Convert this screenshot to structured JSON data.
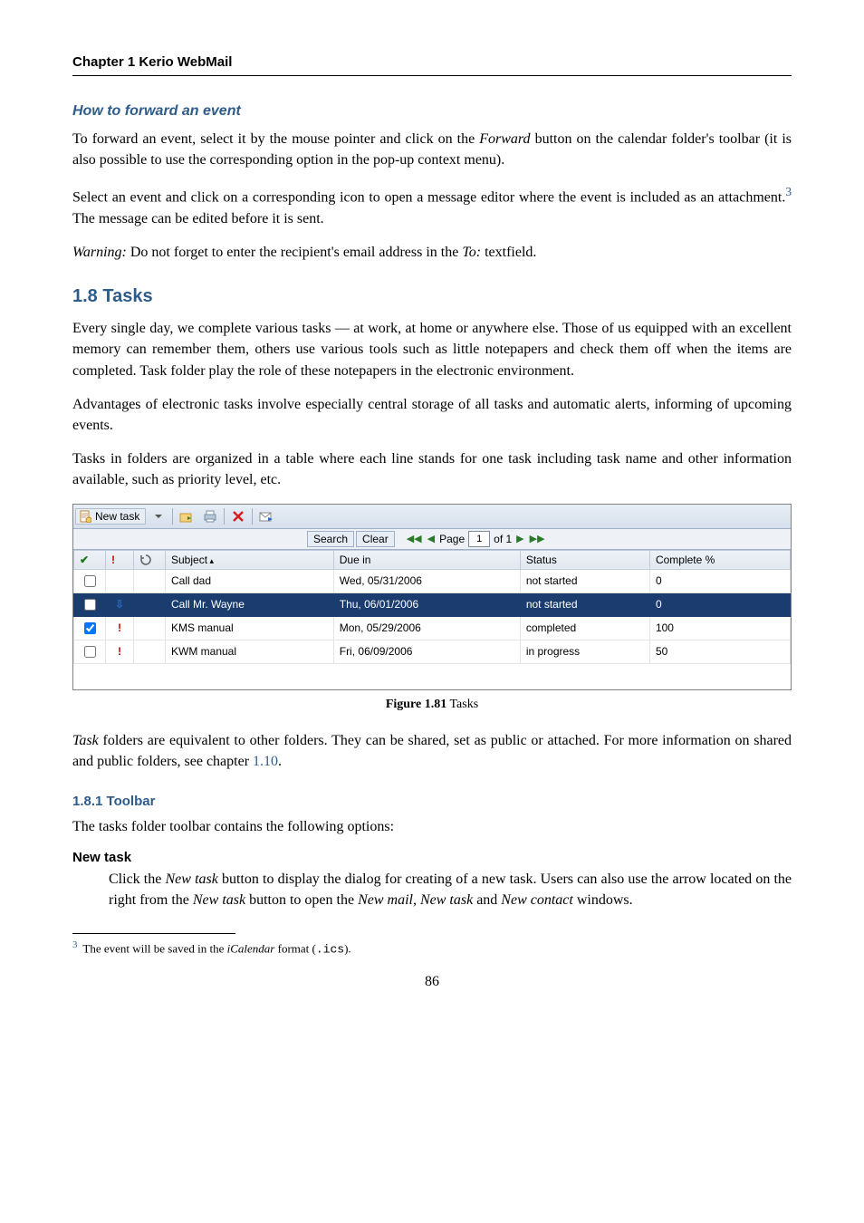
{
  "chapter_header": "Chapter 1  Kerio WebMail",
  "section_forward": {
    "title": "How to forward an event",
    "p1_a": "To forward an event, select it by the mouse pointer and click on the ",
    "p1_em": "Forward",
    "p1_b": " button on the calendar folder's toolbar (it is also possible to use the corresponding option in the pop-up context menu).",
    "p2_a": "Select an event and click on a corresponding icon to open a message editor where the event is included as an attachment.",
    "p2_sup": "3",
    "p2_b": " The message can be edited before it is sent.",
    "p3_em1": "Warning:",
    "p3_a": " Do not forget to enter the recipient's email address in the ",
    "p3_em2": "To:",
    "p3_b": " textfield."
  },
  "section_tasks": {
    "title": "1.8  Tasks",
    "p1": "Every single day, we complete various tasks — at work, at home or anywhere else. Those of us equipped with an excellent memory can remember them, others use various tools such as little notepapers and check them off when the items are completed. Task folder play the role of these notepapers in the electronic environment.",
    "p2": "Advantages of electronic tasks involve especially central storage of all tasks and automatic alerts, informing of upcoming events.",
    "p3": "Tasks in folders are organized in a table where each line stands for one task including task name and other information available, such as priority level, etc.",
    "p_after_fig_a": "Task",
    "p_after_fig_b": " folders are equivalent to other folders. They can be shared, set as public or attached. For more information on shared and public folders, see chapter ",
    "p_after_fig_link": "1.10",
    "p_after_fig_c": "."
  },
  "figure": {
    "caption_bold": "Figure 1.81",
    "caption_rest": "   Tasks",
    "toolbar": {
      "new_task": "New task",
      "search": "Search",
      "clear": "Clear",
      "page_label": "Page",
      "page_value": "1",
      "of_label": "of  1"
    },
    "headers": {
      "subject": "Subject",
      "due": "Due in",
      "status": "Status",
      "complete": "Complete %"
    },
    "rows": [
      {
        "flag": "",
        "subject": "Call dad",
        "due": "Wed, 05/31/2006",
        "status": "not started",
        "complete": "0",
        "checked": false,
        "selected": false
      },
      {
        "flag": "down",
        "subject": "Call Mr. Wayne",
        "due": "Thu, 06/01/2006",
        "status": "not started",
        "complete": "0",
        "checked": false,
        "selected": true
      },
      {
        "flag": "excl",
        "subject": "KMS manual",
        "due": "Mon, 05/29/2006",
        "status": "completed",
        "complete": "100",
        "checked": true,
        "selected": false
      },
      {
        "flag": "excl",
        "subject": "KWM manual",
        "due": "Fri, 06/09/2006",
        "status": "in progress",
        "complete": "50",
        "checked": false,
        "selected": false
      }
    ]
  },
  "section_toolbar": {
    "title": "1.8.1  Toolbar",
    "intro": "The tasks folder toolbar contains the following options:",
    "item_title": "New task",
    "item_body_a": "Click the ",
    "item_body_em1": "New task",
    "item_body_b": " button to display the dialog for creating of a new task. Users can also use the arrow located on the right from the ",
    "item_body_em2": "New task",
    "item_body_c": " button to open the ",
    "item_body_em3": "New mail",
    "item_body_d": ", ",
    "item_body_em4": "New task",
    "item_body_e": " and ",
    "item_body_em5": "New contact",
    "item_body_f": " windows."
  },
  "footnote": {
    "num": "3",
    "a": "The event will be saved in the ",
    "em": "iCalendar",
    "b": " format (",
    "code": ".ics",
    "c": ")."
  },
  "page_number": "86"
}
